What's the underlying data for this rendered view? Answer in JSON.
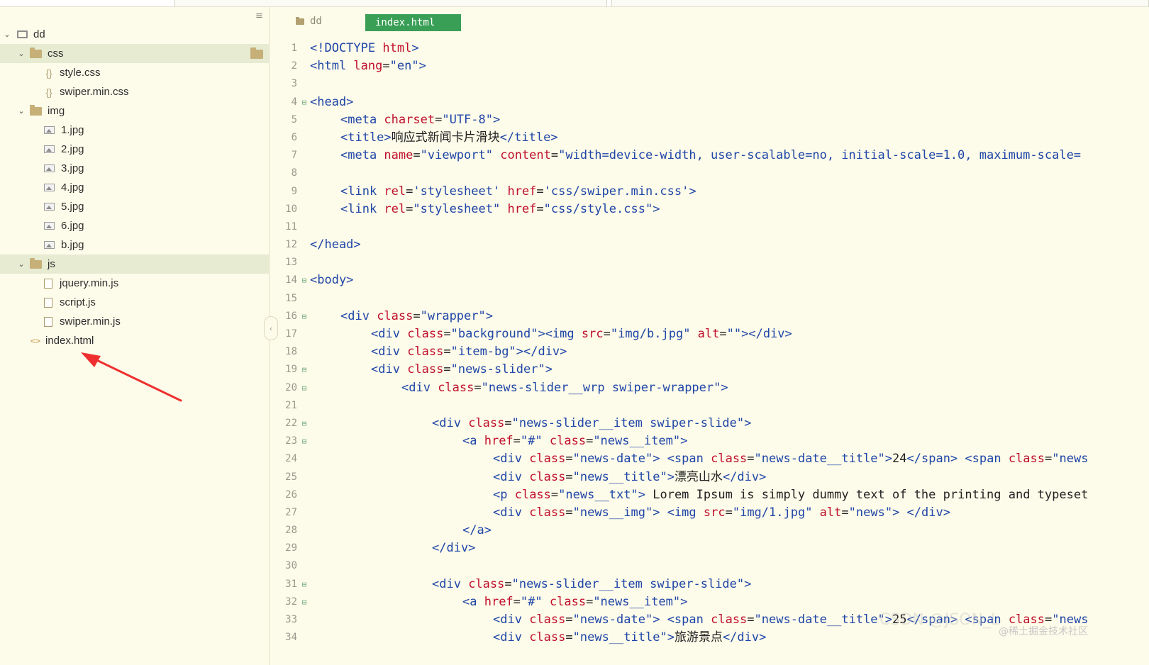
{
  "sidebar": {
    "root": "dd",
    "items": [
      {
        "label": "css",
        "kind": "folder",
        "expanded": true,
        "selected": true
      },
      {
        "label": "style.css",
        "kind": "css"
      },
      {
        "label": "swiper.min.css",
        "kind": "css"
      },
      {
        "label": "img",
        "kind": "folder",
        "expanded": true
      },
      {
        "label": "1.jpg",
        "kind": "image"
      },
      {
        "label": "2.jpg",
        "kind": "image"
      },
      {
        "label": "3.jpg",
        "kind": "image"
      },
      {
        "label": "4.jpg",
        "kind": "image"
      },
      {
        "label": "5.jpg",
        "kind": "image"
      },
      {
        "label": "6.jpg",
        "kind": "image"
      },
      {
        "label": "b.jpg",
        "kind": "image"
      },
      {
        "label": "js",
        "kind": "folder",
        "expanded": true,
        "selected": true
      },
      {
        "label": "jquery.min.js",
        "kind": "js"
      },
      {
        "label": "script.js",
        "kind": "js"
      },
      {
        "label": "swiper.min.js",
        "kind": "js"
      },
      {
        "label": "index.html",
        "kind": "html"
      }
    ]
  },
  "editor": {
    "breadcrumb": "dd",
    "active_tab": "index.html",
    "active_tab_color": "#3a9f56",
    "lines": [
      {
        "n": "1",
        "fold": "",
        "indent": 0,
        "parts": [
          [
            "tg",
            "<!DOCTYPE "
          ],
          [
            "at",
            "html"
          ],
          [
            "tg",
            ">"
          ]
        ]
      },
      {
        "n": "2",
        "fold": "",
        "indent": 0,
        "parts": [
          [
            "tg",
            "<html "
          ],
          [
            "at",
            "lang"
          ],
          [
            "tx",
            "="
          ],
          [
            "st",
            "\"en\""
          ],
          [
            "tg",
            ">"
          ]
        ]
      },
      {
        "n": "3",
        "fold": "",
        "indent": 0,
        "parts": []
      },
      {
        "n": "4",
        "fold": "⊟",
        "indent": 0,
        "parts": [
          [
            "tg",
            "<head>"
          ]
        ]
      },
      {
        "n": "5",
        "fold": "",
        "indent": 1,
        "parts": [
          [
            "tg",
            "<meta "
          ],
          [
            "at",
            "charset"
          ],
          [
            "tx",
            "="
          ],
          [
            "st",
            "\"UTF-8\""
          ],
          [
            "tg",
            ">"
          ]
        ]
      },
      {
        "n": "6",
        "fold": "",
        "indent": 1,
        "parts": [
          [
            "tg",
            "<title>"
          ],
          [
            "tx",
            "响应式新闻卡片滑块"
          ],
          [
            "tg",
            "</title>"
          ]
        ]
      },
      {
        "n": "7",
        "fold": "",
        "indent": 1,
        "parts": [
          [
            "tg",
            "<meta "
          ],
          [
            "at",
            "name"
          ],
          [
            "tx",
            "="
          ],
          [
            "st",
            "\"viewport\" "
          ],
          [
            "at",
            "content"
          ],
          [
            "tx",
            "="
          ],
          [
            "st",
            "\"width=device-width, user-scalable=no, initial-scale=1.0, maximum-scale="
          ]
        ]
      },
      {
        "n": "8",
        "fold": "",
        "indent": 0,
        "parts": []
      },
      {
        "n": "9",
        "fold": "",
        "indent": 1,
        "parts": [
          [
            "tg",
            "<link "
          ],
          [
            "at",
            "rel"
          ],
          [
            "tx",
            "="
          ],
          [
            "st",
            "'stylesheet' "
          ],
          [
            "at",
            "href"
          ],
          [
            "tx",
            "="
          ],
          [
            "st",
            "'css/swiper.min.css'"
          ],
          [
            "tg",
            ">"
          ]
        ]
      },
      {
        "n": "10",
        "fold": "",
        "indent": 1,
        "parts": [
          [
            "tg",
            "<link "
          ],
          [
            "at",
            "rel"
          ],
          [
            "tx",
            "="
          ],
          [
            "st",
            "\"stylesheet\" "
          ],
          [
            "at",
            "href"
          ],
          [
            "tx",
            "="
          ],
          [
            "st",
            "\"css/style.css\""
          ],
          [
            "tg",
            ">"
          ]
        ]
      },
      {
        "n": "11",
        "fold": "",
        "indent": 0,
        "parts": []
      },
      {
        "n": "12",
        "fold": "",
        "indent": 0,
        "parts": [
          [
            "tg",
            "</head>"
          ]
        ]
      },
      {
        "n": "13",
        "fold": "",
        "indent": 0,
        "parts": []
      },
      {
        "n": "14",
        "fold": "⊟",
        "indent": 0,
        "parts": [
          [
            "tg",
            "<body>"
          ]
        ]
      },
      {
        "n": "15",
        "fold": "",
        "indent": 0,
        "parts": []
      },
      {
        "n": "16",
        "fold": "⊟",
        "indent": 1,
        "parts": [
          [
            "tg",
            "<div "
          ],
          [
            "at",
            "class"
          ],
          [
            "tx",
            "="
          ],
          [
            "st",
            "\"wrapper\""
          ],
          [
            "tg",
            ">"
          ]
        ]
      },
      {
        "n": "17",
        "fold": "",
        "indent": 2,
        "parts": [
          [
            "tg",
            "<div "
          ],
          [
            "at",
            "class"
          ],
          [
            "tx",
            "="
          ],
          [
            "st",
            "\"background\""
          ],
          [
            "tg",
            "><img "
          ],
          [
            "at",
            "src"
          ],
          [
            "tx",
            "="
          ],
          [
            "st",
            "\"img/b.jpg\" "
          ],
          [
            "at",
            "alt"
          ],
          [
            "tx",
            "="
          ],
          [
            "st",
            "\"\""
          ],
          [
            "tg",
            "></div>"
          ]
        ]
      },
      {
        "n": "18",
        "fold": "",
        "indent": 2,
        "parts": [
          [
            "tg",
            "<div "
          ],
          [
            "at",
            "class"
          ],
          [
            "tx",
            "="
          ],
          [
            "st",
            "\"item-bg\""
          ],
          [
            "tg",
            "></div>"
          ]
        ]
      },
      {
        "n": "19",
        "fold": "⊟",
        "indent": 2,
        "parts": [
          [
            "tg",
            "<div "
          ],
          [
            "at",
            "class"
          ],
          [
            "tx",
            "="
          ],
          [
            "st",
            "\"news-slider\""
          ],
          [
            "tg",
            ">"
          ]
        ]
      },
      {
        "n": "20",
        "fold": "⊟",
        "indent": 3,
        "parts": [
          [
            "tg",
            "<div "
          ],
          [
            "at",
            "class"
          ],
          [
            "tx",
            "="
          ],
          [
            "st",
            "\"news-slider__wrp swiper-wrapper\""
          ],
          [
            "tg",
            ">"
          ]
        ]
      },
      {
        "n": "21",
        "fold": "",
        "indent": 0,
        "parts": []
      },
      {
        "n": "22",
        "fold": "⊟",
        "indent": 4,
        "parts": [
          [
            "tg",
            "<div "
          ],
          [
            "at",
            "class"
          ],
          [
            "tx",
            "="
          ],
          [
            "st",
            "\"news-slider__item swiper-slide\""
          ],
          [
            "tg",
            ">"
          ]
        ]
      },
      {
        "n": "23",
        "fold": "⊟",
        "indent": 5,
        "parts": [
          [
            "tg",
            "<a "
          ],
          [
            "at",
            "href"
          ],
          [
            "tx",
            "="
          ],
          [
            "st",
            "\"#\" "
          ],
          [
            "at",
            "class"
          ],
          [
            "tx",
            "="
          ],
          [
            "st",
            "\"news__item\""
          ],
          [
            "tg",
            ">"
          ]
        ]
      },
      {
        "n": "24",
        "fold": "",
        "indent": 6,
        "parts": [
          [
            "tg",
            "<div "
          ],
          [
            "at",
            "class"
          ],
          [
            "tx",
            "="
          ],
          [
            "st",
            "\"news-date\""
          ],
          [
            "tg",
            "> <span "
          ],
          [
            "at",
            "class"
          ],
          [
            "tx",
            "="
          ],
          [
            "st",
            "\"news-date__title\""
          ],
          [
            "tg",
            ">"
          ],
          [
            "tx",
            "24"
          ],
          [
            "tg",
            "</span> <span "
          ],
          [
            "at",
            "class"
          ],
          [
            "tx",
            "="
          ],
          [
            "st",
            "\"news"
          ]
        ]
      },
      {
        "n": "25",
        "fold": "",
        "indent": 6,
        "parts": [
          [
            "tg",
            "<div "
          ],
          [
            "at",
            "class"
          ],
          [
            "tx",
            "="
          ],
          [
            "st",
            "\"news__title\""
          ],
          [
            "tg",
            ">"
          ],
          [
            "tx",
            "漂亮山水"
          ],
          [
            "tg",
            "</div>"
          ]
        ]
      },
      {
        "n": "26",
        "fold": "",
        "indent": 6,
        "parts": [
          [
            "tg",
            "<p "
          ],
          [
            "at",
            "class"
          ],
          [
            "tx",
            "="
          ],
          [
            "st",
            "\"news__txt\""
          ],
          [
            "tg",
            "> "
          ],
          [
            "tx",
            "Lorem Ipsum is simply dummy text of the printing and typeset"
          ]
        ]
      },
      {
        "n": "27",
        "fold": "",
        "indent": 6,
        "parts": [
          [
            "tg",
            "<div "
          ],
          [
            "at",
            "class"
          ],
          [
            "tx",
            "="
          ],
          [
            "st",
            "\"news__img\""
          ],
          [
            "tg",
            "> <img "
          ],
          [
            "at",
            "src"
          ],
          [
            "tx",
            "="
          ],
          [
            "st",
            "\"img/1.jpg\" "
          ],
          [
            "at",
            "alt"
          ],
          [
            "tx",
            "="
          ],
          [
            "st",
            "\"news\""
          ],
          [
            "tg",
            "> </div>"
          ]
        ]
      },
      {
        "n": "28",
        "fold": "",
        "indent": 5,
        "parts": [
          [
            "tg",
            "</a>"
          ]
        ]
      },
      {
        "n": "29",
        "fold": "",
        "indent": 4,
        "parts": [
          [
            "tg",
            "</div>"
          ]
        ]
      },
      {
        "n": "30",
        "fold": "",
        "indent": 0,
        "parts": []
      },
      {
        "n": "31",
        "fold": "⊟",
        "indent": 4,
        "parts": [
          [
            "tg",
            "<div "
          ],
          [
            "at",
            "class"
          ],
          [
            "tx",
            "="
          ],
          [
            "st",
            "\"news-slider__item swiper-slide\""
          ],
          [
            "tg",
            ">"
          ]
        ]
      },
      {
        "n": "32",
        "fold": "⊟",
        "indent": 5,
        "parts": [
          [
            "tg",
            "<a "
          ],
          [
            "at",
            "href"
          ],
          [
            "tx",
            "="
          ],
          [
            "st",
            "\"#\" "
          ],
          [
            "at",
            "class"
          ],
          [
            "tx",
            "="
          ],
          [
            "st",
            "\"news__item\""
          ],
          [
            "tg",
            ">"
          ]
        ]
      },
      {
        "n": "33",
        "fold": "",
        "indent": 6,
        "parts": [
          [
            "tg",
            "<div "
          ],
          [
            "at",
            "class"
          ],
          [
            "tx",
            "="
          ],
          [
            "st",
            "\"news-date\""
          ],
          [
            "tg",
            "> <span "
          ],
          [
            "at",
            "class"
          ],
          [
            "tx",
            "="
          ],
          [
            "st",
            "\"news-date__title\""
          ],
          [
            "tg",
            ">"
          ],
          [
            "tx",
            "25"
          ],
          [
            "tg",
            "</span> <span "
          ],
          [
            "at",
            "class"
          ],
          [
            "tx",
            "="
          ],
          [
            "st",
            "\"news"
          ]
        ]
      },
      {
        "n": "34",
        "fold": "",
        "indent": 6,
        "parts": [
          [
            "tg",
            "<div "
          ],
          [
            "at",
            "class"
          ],
          [
            "tx",
            "="
          ],
          [
            "st",
            "\"news__title\""
          ],
          [
            "tg",
            ">"
          ],
          [
            "tx",
            "旅游景点"
          ],
          [
            "tg",
            "</div>"
          ]
        ]
      }
    ]
  },
  "watermark": "@稀土掘金技术社区",
  "watermark_faint": "CSDN @JSON_L"
}
